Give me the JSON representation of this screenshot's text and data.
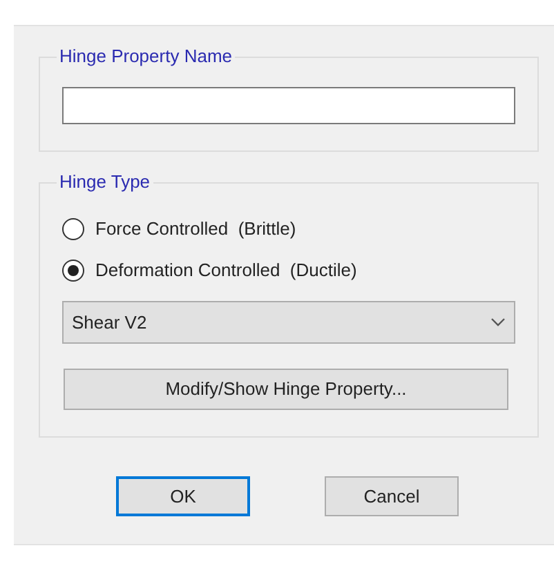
{
  "name_group": {
    "title": "Hinge Property Name"
  },
  "type_group": {
    "title": "Hinge Type",
    "options": [
      {
        "label": "Force Controlled  (Brittle)",
        "selected": false
      },
      {
        "label": "Deformation Controlled  (Ductile)",
        "selected": true
      }
    ],
    "dropdown": {
      "value": "Shear V2"
    },
    "action_button": "Modify/Show Hinge Property..."
  },
  "buttons": [
    {
      "label": "OK",
      "default": true
    },
    {
      "label": "Cancel",
      "default": false
    }
  ]
}
